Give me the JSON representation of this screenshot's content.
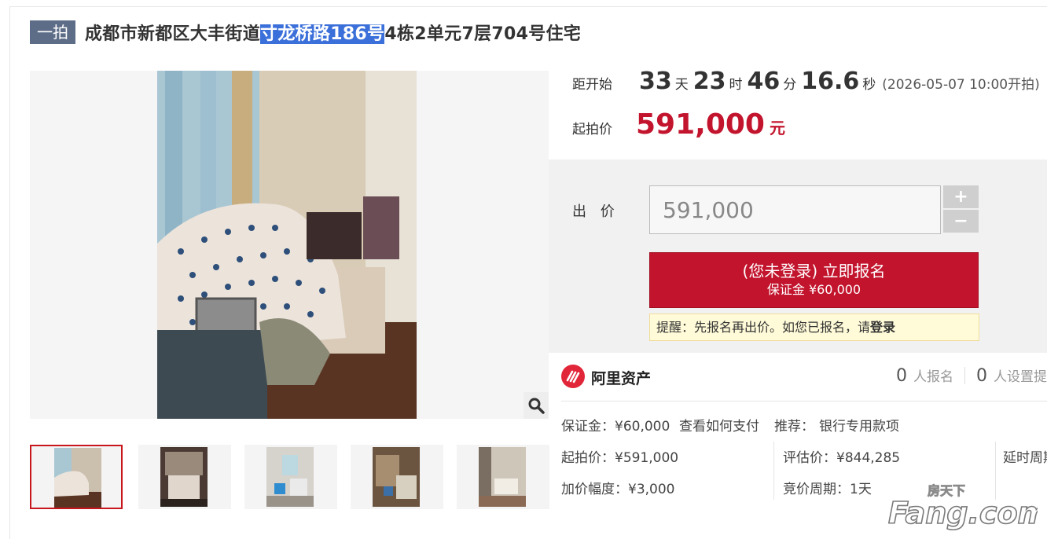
{
  "header": {
    "badge": "一拍",
    "title_prefix": "成都市新都区大丰街道",
    "title_highlight": "寸龙桥路186号",
    "title_suffix": "4栋2单元7层704号住宅"
  },
  "countdown": {
    "label": "距开始",
    "days": "33",
    "days_unit": "天",
    "hours": "23",
    "hours_unit": "时",
    "minutes": "46",
    "minutes_unit": "分",
    "seconds": "16.6",
    "seconds_unit": "秒",
    "start_time": "(2026-05-07 10:00开拍)"
  },
  "starting_price": {
    "label": "起拍价",
    "value": "591,000",
    "unit": "元"
  },
  "bid": {
    "label": "出 价",
    "input_value": "591,000",
    "plus": "+",
    "minus": "−",
    "signup_line1": "(您未登录) 立即报名",
    "signup_line2": "保证金 ¥60,000",
    "remind_text": "提醒：先报名再出价。如您已报名，请",
    "remind_link": "登录"
  },
  "org": {
    "name": "阿里资产",
    "signup_count": "0",
    "signup_label": "人报名",
    "reminder_count": "0",
    "reminder_label": "人设置提醒"
  },
  "details": {
    "deposit": "保证金：¥60,000",
    "how_to_pay": "查看如何支付",
    "recommend_label": "推荐：",
    "recommend_value": "银行专用款项",
    "start_price": "起拍价：¥591,000",
    "assessed_price": "评估价：¥844,285",
    "delay_cycle": "延时周期",
    "increment": "加价幅度：¥3,000",
    "bid_cycle": "竞价周期：1天"
  },
  "watermark": {
    "cn": "房天下",
    "en": "Fang.com"
  },
  "thumbnails_count": 5,
  "colors": {
    "accent_red": "#c3142d",
    "badge_bg": "#5d6d87",
    "link_blue": "#3e7bc2",
    "highlight_blue": "#3b6fd9"
  }
}
